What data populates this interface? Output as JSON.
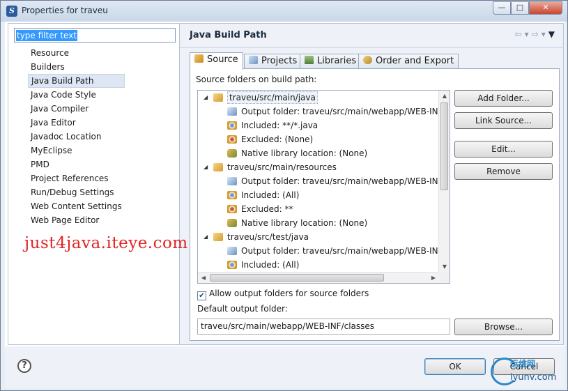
{
  "window": {
    "title": "Properties for traveu",
    "controls": {
      "minimize": "—",
      "maximize": "□",
      "close": "✕"
    }
  },
  "filter": {
    "placeholder": "type filter text",
    "value": "type filter text"
  },
  "sidebar": {
    "items": [
      {
        "label": "Resource",
        "selected": false
      },
      {
        "label": "Builders",
        "selected": false
      },
      {
        "label": "Java Build Path",
        "selected": true
      },
      {
        "label": "Java Code Style",
        "selected": false
      },
      {
        "label": "Java Compiler",
        "selected": false
      },
      {
        "label": "Java Editor",
        "selected": false
      },
      {
        "label": "Javadoc Location",
        "selected": false
      },
      {
        "label": "MyEclipse",
        "selected": false
      },
      {
        "label": "PMD",
        "selected": false
      },
      {
        "label": "Project References",
        "selected": false
      },
      {
        "label": "Run/Debug Settings",
        "selected": false
      },
      {
        "label": "Web Content Settings",
        "selected": false
      },
      {
        "label": "Web Page Editor",
        "selected": false
      }
    ]
  },
  "page": {
    "title": "Java Build Path",
    "nav_icons": [
      "back-arrow-icon",
      "dropdown-icon",
      "forward-arrow-icon",
      "dropdown-icon",
      "view-menu-icon"
    ]
  },
  "tabs": [
    {
      "label": "Source",
      "icon": "source-folder-icon",
      "active": true
    },
    {
      "label": "Projects",
      "icon": "projects-icon",
      "active": false
    },
    {
      "label": "Libraries",
      "icon": "libraries-icon",
      "active": false
    },
    {
      "label": "Order and Export",
      "icon": "order-export-icon",
      "active": false
    }
  ],
  "source": {
    "label": "Source folders on build path:",
    "tree": [
      {
        "level": 0,
        "icon": "source-folder-icon",
        "text": "traveu/src/main/java",
        "expanded": true,
        "selected": true
      },
      {
        "level": 1,
        "icon": "output-folder-icon",
        "text": "Output folder: traveu/src/main/webapp/WEB-INF/classes"
      },
      {
        "level": 1,
        "icon": "inclusion-filter-icon",
        "text": "Included: **/*.java"
      },
      {
        "level": 1,
        "icon": "exclusion-filter-icon",
        "text": "Excluded: (None)"
      },
      {
        "level": 1,
        "icon": "native-library-icon",
        "text": "Native library location: (None)"
      },
      {
        "level": 0,
        "icon": "source-folder-icon",
        "text": "traveu/src/main/resources",
        "expanded": true,
        "selected": false
      },
      {
        "level": 1,
        "icon": "output-folder-icon",
        "text": "Output folder: traveu/src/main/webapp/WEB-INF/classes"
      },
      {
        "level": 1,
        "icon": "inclusion-filter-icon",
        "text": "Included: (All)"
      },
      {
        "level": 1,
        "icon": "exclusion-filter-icon",
        "text": "Excluded: **"
      },
      {
        "level": 1,
        "icon": "native-library-icon",
        "text": "Native library location: (None)"
      },
      {
        "level": 0,
        "icon": "source-folder-icon",
        "text": "traveu/src/test/java",
        "expanded": true,
        "selected": false
      },
      {
        "level": 1,
        "icon": "output-folder-icon",
        "text": "Output folder: traveu/src/main/webapp/WEB-INF/classes"
      },
      {
        "level": 1,
        "icon": "inclusion-filter-icon",
        "text": "Included: (All)"
      }
    ],
    "buttons": {
      "add_folder": "Add Folder...",
      "link_source": "Link Source...",
      "edit": "Edit...",
      "remove": "Remove"
    },
    "allow_output_folders": {
      "label": "Allow output folders for source folders",
      "checked": true
    },
    "default_output_label": "Default output folder:",
    "default_output_value": "traveu/src/main/webapp/WEB-INF/classes",
    "browse": "Browse..."
  },
  "footer": {
    "help": "?",
    "ok": "OK",
    "cancel": "Cancel"
  },
  "watermark": {
    "text": "just4java.iteye.com",
    "logo_cn": "运维网",
    "logo_url": "iyunv.com"
  },
  "colors": {
    "selection_blue": "#3399ff",
    "watermark_red": "#e32222",
    "logo_blue": "#2b86c8"
  }
}
